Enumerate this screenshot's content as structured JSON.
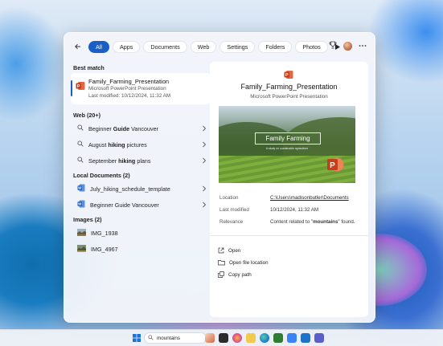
{
  "filters": {
    "back_label": "Back",
    "chips": [
      "All",
      "Apps",
      "Documents",
      "Web",
      "Settings",
      "Folders",
      "Photos"
    ]
  },
  "left": {
    "best_match_title": "Best match",
    "best_match": {
      "name": "Family_Farming_Presentation",
      "type": "Microsoft PowerPoint Presentation",
      "modified": "Last modified: 10/12/2024, 11:32 AM"
    },
    "web_title": "Web (20+)",
    "web_items": [
      {
        "pre": "Beginner ",
        "bold": "Guide",
        "post": " Vancouver"
      },
      {
        "pre": "August ",
        "bold": "hiking",
        "post": " pictures"
      },
      {
        "pre": "September ",
        "bold": "hiking",
        "post": " plans"
      }
    ],
    "docs_title": "Local Documents (2)",
    "docs": [
      "July_hiking_schedule_template",
      "Beginner Guide Vancouver"
    ],
    "images_title": "Images (2)",
    "images": [
      "IMG_1938",
      "IMG_4967"
    ]
  },
  "preview": {
    "title": "Family_Farming_Presentation",
    "subtitle": "Microsoft PowerPoint Presentation",
    "thumb_title": "Family Farming",
    "thumb_sub": "A study on sustainable agriculture",
    "props": {
      "location_key": "Location",
      "location_val": "C:\\Users\\madisonbutler\\Documents",
      "modified_key": "Last modified",
      "modified_val": "10/12/2024, 11:32 AM",
      "relevance_key": "Relevance",
      "relevance_pre": "Content related to \"",
      "relevance_bold": "mountains",
      "relevance_post": "\" found."
    },
    "actions": [
      "Open",
      "Open file location",
      "Copy path"
    ]
  },
  "taskbar": {
    "search_text": "mountains"
  },
  "colors": {
    "accent": "#1a5fc8",
    "powerpoint": "#c43e1c"
  }
}
